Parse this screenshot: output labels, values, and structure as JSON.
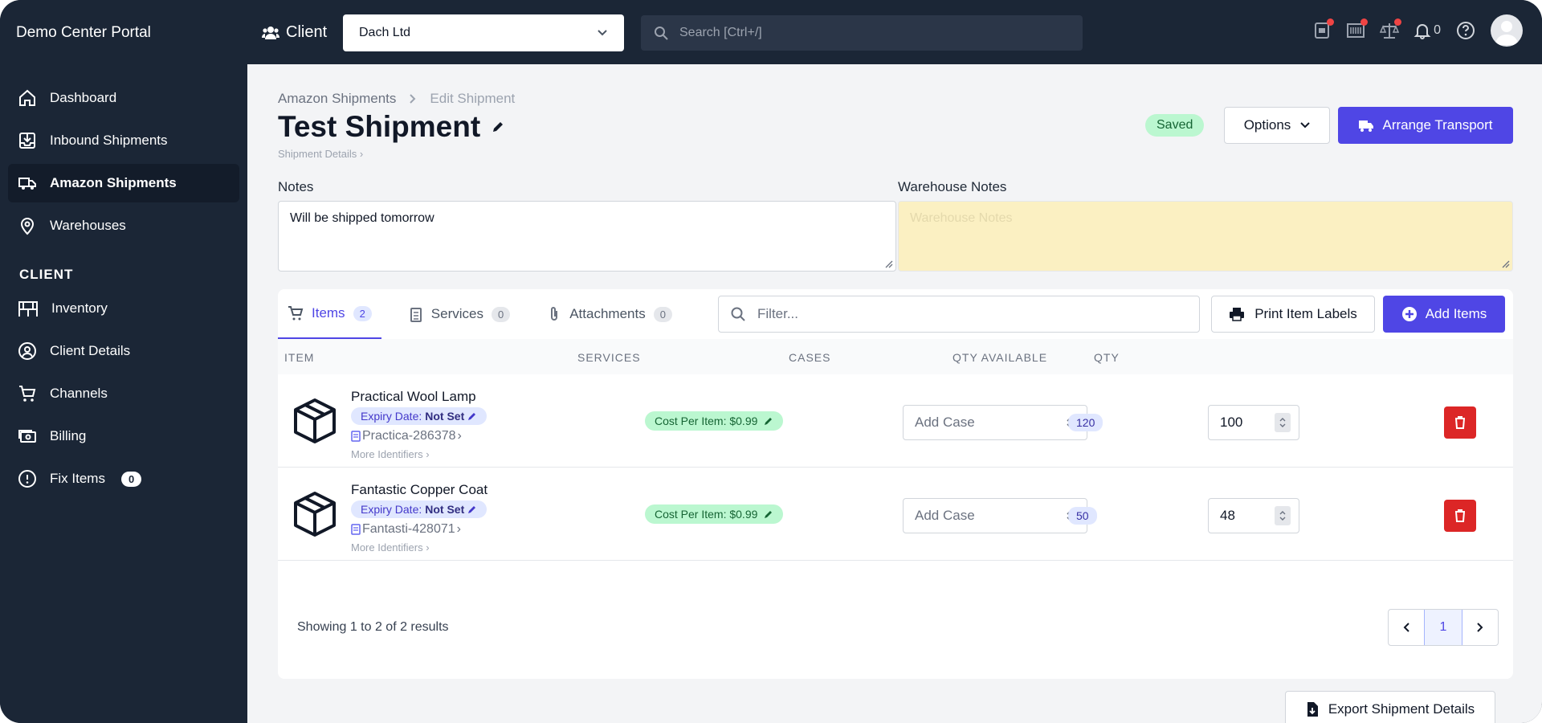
{
  "app": {
    "brand": "Demo Center Portal"
  },
  "topbar": {
    "client_label": "Client",
    "client_value": "Dach Ltd",
    "search_placeholder": "Search [Ctrl+/]",
    "notification_count": "0",
    "icons": [
      "users-icon",
      "chevron-down-icon",
      "search-icon",
      "printer-icon",
      "barcode-icon",
      "scale-icon",
      "bell-icon",
      "help-icon",
      "avatar"
    ]
  },
  "sidebar": {
    "items": [
      {
        "label": "Dashboard",
        "icon": "home-icon"
      },
      {
        "label": "Inbound Shipments",
        "icon": "inbox-icon"
      },
      {
        "label": "Amazon Shipments",
        "icon": "truck-icon",
        "active": true
      },
      {
        "label": "Warehouses",
        "icon": "map-pin-icon"
      }
    ],
    "section_label": "CLIENT",
    "client_items": [
      {
        "label": "Inventory",
        "icon": "shelves-icon"
      },
      {
        "label": "Client Details",
        "icon": "user-circle-icon"
      },
      {
        "label": "Channels",
        "icon": "cart-icon"
      },
      {
        "label": "Billing",
        "icon": "cash-icon"
      },
      {
        "label": "Fix Items",
        "icon": "alert-icon",
        "badge": "0"
      }
    ]
  },
  "header": {
    "breadcrumb": [
      "Amazon Shipments",
      "Edit Shipment"
    ],
    "title": "Test Shipment",
    "sublink": "Shipment Details",
    "status": "Saved",
    "options_label": "Options",
    "transport_label": "Arrange Transport"
  },
  "notes": {
    "label": "Notes",
    "value": "Will be shipped tomorrow",
    "warehouse_label": "Warehouse Notes",
    "warehouse_placeholder": "Warehouse Notes"
  },
  "tabs": [
    {
      "label": "Items",
      "count": "2",
      "icon": "cart-icon"
    },
    {
      "label": "Services",
      "count": "0",
      "icon": "clipboard-icon"
    },
    {
      "label": "Attachments",
      "count": "0",
      "icon": "paperclip-icon"
    }
  ],
  "toolbar": {
    "filter_placeholder": "Filter...",
    "print_label": "Print Item Labels",
    "add_label": "Add Items"
  },
  "table": {
    "columns": [
      "ITEM",
      "SERVICES",
      "CASES",
      "QTY AVAILABLE",
      "QTY"
    ],
    "rows": [
      {
        "name": "Practical Wool Lamp",
        "expiry_prefix": "Expiry Date:",
        "expiry_value": "Not Set",
        "sku": "Practica-286378",
        "more": "More Identifiers",
        "service": "Cost Per Item: $0.99",
        "case_placeholder": "Add Case",
        "qty_available": "120",
        "qty": "100"
      },
      {
        "name": "Fantastic Copper Coat",
        "expiry_prefix": "Expiry Date:",
        "expiry_value": "Not Set",
        "sku": "Fantasti-428071",
        "more": "More Identifiers",
        "service": "Cost Per Item: $0.99",
        "case_placeholder": "Add Case",
        "qty_available": "50",
        "qty": "48"
      }
    ]
  },
  "footer": {
    "results_text": "Showing 1 to 2 of 2 results",
    "page": "1",
    "export_label": "Export Shipment Details"
  },
  "colors": {
    "sidebar_bg": "#1b2636",
    "accent": "#4f46e5",
    "danger": "#dc2626",
    "success_bg": "#bbf7d0",
    "warehouse_notes_bg": "#fbf0c2"
  }
}
